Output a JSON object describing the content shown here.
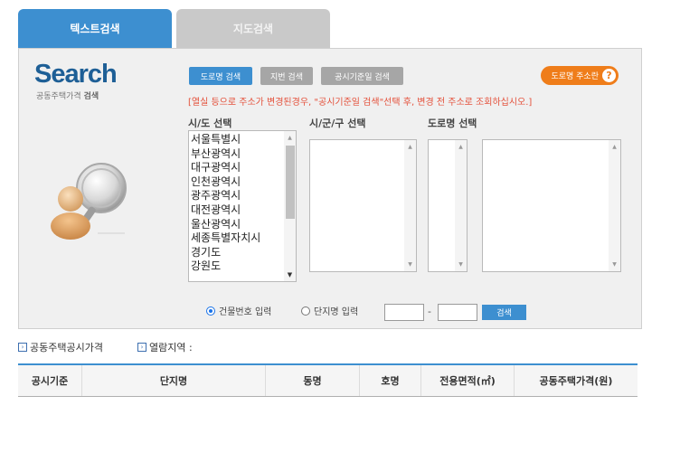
{
  "tabs": [
    {
      "label": "텍스트검색"
    },
    {
      "label": "지도검색"
    }
  ],
  "logo": {
    "title": "Search",
    "sub_prefix": "공동주택가격",
    "sub_bold": "검색"
  },
  "search_type_buttons": {
    "road": "도로명 검색",
    "lot": "지번 검색",
    "notice_date": "공시기준일 검색"
  },
  "guide_button": {
    "label": "도로명 주소란",
    "icon": "?"
  },
  "notice": "[열실 등으로 주소가 변경된경우, \"공시기준일 검색\"선택 후, 변경 전 주소로 조회하십시오.]",
  "columns": {
    "sido": "시/도 선택",
    "sigungu": "시/군/구 선택",
    "road": "도로명 선택"
  },
  "sido_options": [
    "서울특별시",
    "부산광역시",
    "대구광역시",
    "인천광역시",
    "광주광역시",
    "대전광역시",
    "울산광역시",
    "세종특별자치시",
    "경기도",
    "강원도"
  ],
  "radios": {
    "building": "건물번호 입력",
    "complex": "단지명 입력",
    "selected": "building"
  },
  "search_button": "검색",
  "dash": "-",
  "info": {
    "price": "공동주택공시가격",
    "area_label": "열람지역 :"
  },
  "table_headers": [
    "공시기준",
    "단지명",
    "동명",
    "호명",
    "전용면적(㎡)",
    "공동주택가격(원)"
  ],
  "colors": {
    "accent": "#3d8fd0",
    "orange": "#ef7d1a",
    "notice_red": "#e4503a"
  }
}
